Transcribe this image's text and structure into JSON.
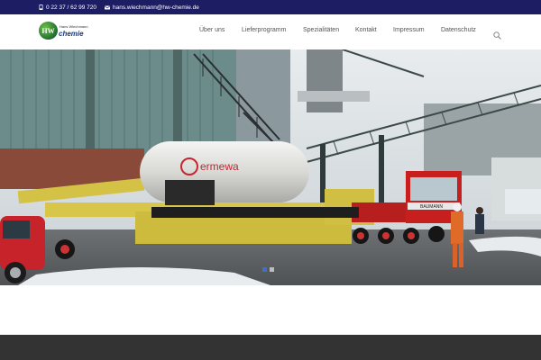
{
  "topbar": {
    "phone": "0 22 37 / 62 99 720",
    "email": "hans.wiechmann@hw-chemie.de",
    "phone_icon": "phone-icon",
    "email_icon": "envelope-icon"
  },
  "logo": {
    "mark": "HW",
    "name": "Hans Wiechmann",
    "brand": "chemie"
  },
  "nav": {
    "items": [
      {
        "label": "Über uns"
      },
      {
        "label": "Lieferprogramm"
      },
      {
        "label": "Spezialitäten"
      },
      {
        "label": "Kontakt"
      },
      {
        "label": "Impressum"
      },
      {
        "label": "Datenschutz"
      }
    ],
    "search_icon": "search-icon"
  },
  "hero": {
    "tank_text": "ermewa",
    "truck_text": "BAUMANN",
    "slides": 2,
    "active_slide": 1
  },
  "colors": {
    "topbar": "#1d1d63",
    "nav_text": "#555555",
    "footer": "#333333",
    "slider_active": "#3b6fd0"
  }
}
